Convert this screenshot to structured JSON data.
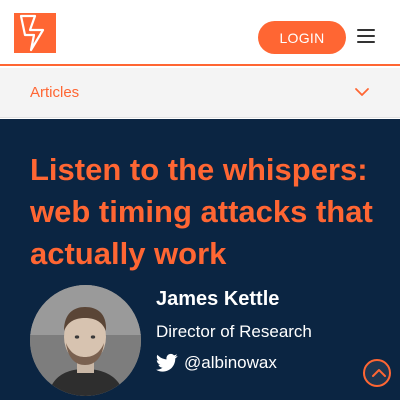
{
  "header": {
    "logo_icon": "lightning-bolt-logo-icon",
    "login_label": "LOGIN",
    "menu_icon": "hamburger-menu-icon"
  },
  "articles_bar": {
    "label": "Articles",
    "chevron_icon": "chevron-down-icon"
  },
  "hero": {
    "title": "Listen to the whispers: web timing attacks that actually work",
    "author": {
      "name": "James Kettle",
      "role": "Director of Research",
      "twitter_icon": "twitter-bird-icon",
      "twitter_handle": "@albinowax",
      "photo": "author-avatar"
    }
  },
  "scroll_top_icon": "chevron-up-circle-icon",
  "colors": {
    "accent": "#ff6633",
    "hero_background": "#0b2542",
    "articles_bar_background": "#f4f4f4"
  }
}
